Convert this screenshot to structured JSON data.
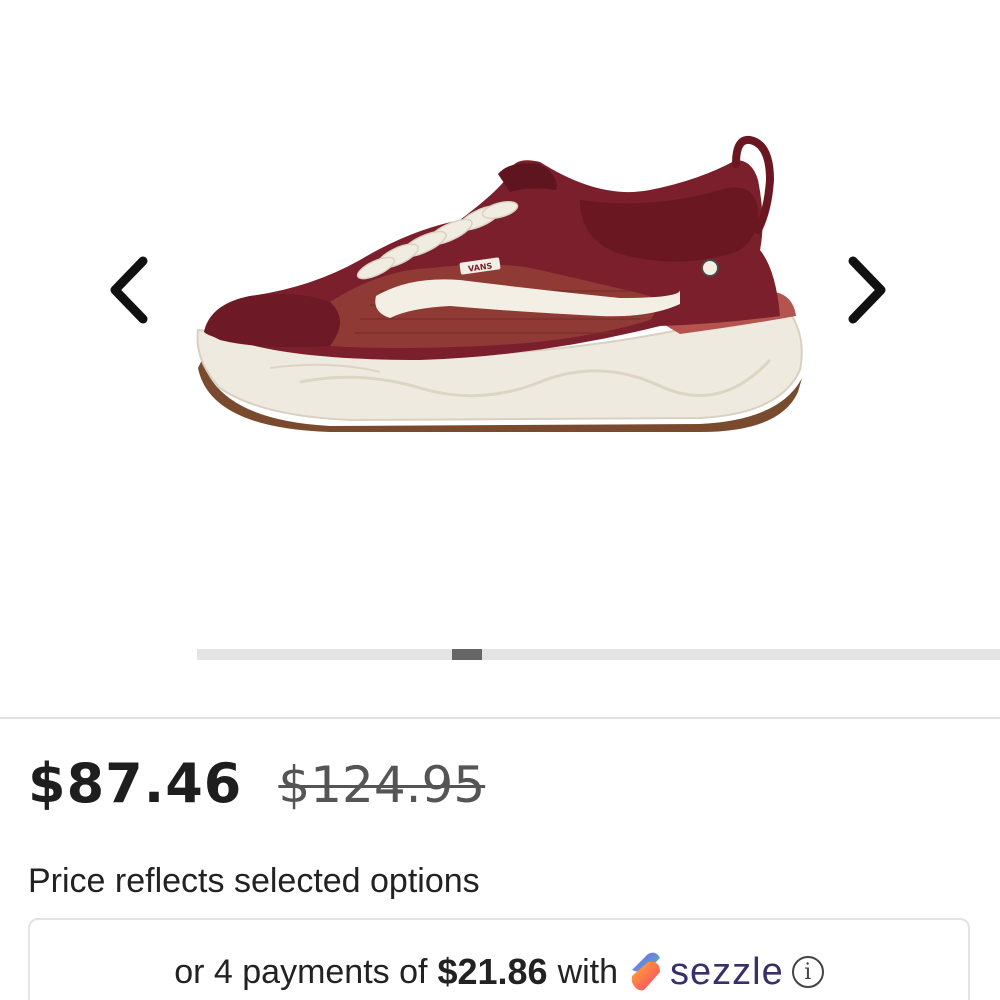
{
  "gallery": {
    "product_image_alt": "Vans sneaker in burgundy with white side stripe",
    "logo_text": "VANS",
    "prev_icon": "chevron-left-icon",
    "next_icon": "chevron-right-icon",
    "scroll_position": 0.33
  },
  "pricing": {
    "sale_price": "$87.46",
    "original_price": "$124.95",
    "note": "Price reflects selected options"
  },
  "sezzle": {
    "prefix": "or 4 payments of",
    "amount": "$21.86",
    "with": "with",
    "brand": "sezzle",
    "brand_icon": "sezzle-logo-icon",
    "info_icon": "info-icon",
    "info_glyph": "i"
  },
  "colors": {
    "burgundy": "#7a1f2b",
    "sole_cream": "#efeadf",
    "gum_outsole": "#7a4a2e",
    "sezzle_purple": "#392f6b"
  }
}
